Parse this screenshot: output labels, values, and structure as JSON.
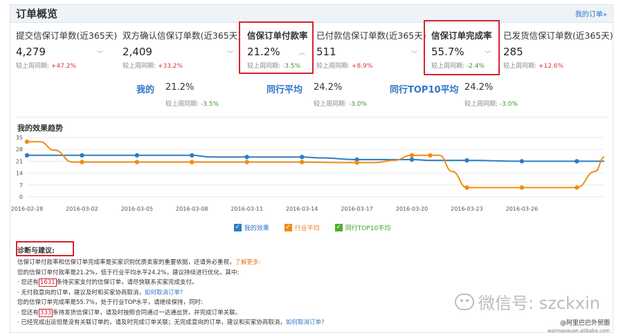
{
  "header": {
    "title": "订单概览",
    "my_orders_link": "我的订单»"
  },
  "metrics": [
    {
      "label": "提交信保订单数(近365天)",
      "value": "4,279",
      "compare_label": "较上周同期:",
      "compare_value": "+47.2%",
      "direction": "up",
      "highlighted": false
    },
    {
      "label": "双方确认信保订单数(近365天)",
      "value": "2,409",
      "compare_label": "较上周同期:",
      "compare_value": "+33.2%",
      "direction": "up",
      "highlighted": false
    },
    {
      "label": "信保订单付款率",
      "value": "21.2%",
      "compare_label": "较上周同期:",
      "compare_value": "-3.5%",
      "direction": "down",
      "highlighted": true
    },
    {
      "label": "已付款信保订单数(近365天)",
      "value": "511",
      "compare_label": "较上周同期:",
      "compare_value": "+8.9%",
      "direction": "up",
      "highlighted": false
    },
    {
      "label": "信保订单完成率",
      "value": "55.7%",
      "compare_label": "较上周同期:",
      "compare_value": "-2.4%",
      "direction": "down",
      "highlighted": true
    },
    {
      "label": "已发货信保订单数(近365天)",
      "value": "285",
      "compare_label": "较上周同期:",
      "compare_value": "+12.6%",
      "direction": "up",
      "highlighted": false
    }
  ],
  "comparison": [
    {
      "label": "我的",
      "value": "21.2%",
      "compare_label": "较上周同期:",
      "compare_value": "-3.5%"
    },
    {
      "label": "同行平均",
      "value": "24.2%",
      "compare_label": "较上周同期:",
      "compare_value": "-3.0%"
    },
    {
      "label": "同行TOP10平均",
      "value": "24.2%",
      "compare_label": "较上周同期:",
      "compare_value": "-3.0%"
    }
  ],
  "chart_title": "我的效果趋势",
  "chart_data": {
    "type": "line",
    "ylim": [
      0,
      35
    ],
    "yticks": [
      0,
      7,
      14,
      21,
      28,
      35
    ],
    "x_labels": [
      "2016-02-28",
      "2016-03-02",
      "2016-03-05",
      "2016-03-08",
      "2016-03-11",
      "2016-03-14",
      "2016-03-17",
      "2016-03-20",
      "2016-03-23",
      "2016-03-26"
    ],
    "grid": true,
    "series": [
      {
        "name": "我的效果",
        "color": "#2a7dc8",
        "points": [
          [
            0,
            24.5
          ],
          [
            3,
            24.5
          ],
          [
            6,
            24.5
          ],
          [
            9,
            24.5
          ],
          [
            10,
            23.5
          ],
          [
            12,
            23.5
          ],
          [
            15,
            23.5
          ],
          [
            16,
            23.0
          ],
          [
            18,
            22.0
          ],
          [
            21,
            22.0
          ],
          [
            22,
            21.5
          ],
          [
            24,
            21.5
          ],
          [
            27,
            21.0
          ],
          [
            30,
            21.0
          ],
          [
            31.5,
            21.0
          ]
        ],
        "markers": [
          0,
          3,
          6,
          9,
          12,
          15,
          18,
          21,
          24,
          27,
          30
        ]
      },
      {
        "name": "行业平均",
        "color": "#f08c14",
        "points": [
          [
            0,
            32.5
          ],
          [
            0.7,
            32.5
          ],
          [
            1.5,
            27.5
          ],
          [
            2.5,
            20.5
          ],
          [
            6,
            20.5
          ],
          [
            9,
            20.5
          ],
          [
            12,
            20.5
          ],
          [
            15,
            20.5
          ],
          [
            17,
            20.2
          ],
          [
            19,
            20.2
          ],
          [
            20,
            21.5
          ],
          [
            21,
            24.5
          ],
          [
            22.5,
            24.5
          ],
          [
            23.2,
            15.0
          ],
          [
            24,
            5.5
          ],
          [
            27,
            5.5
          ],
          [
            29,
            5.5
          ],
          [
            30,
            5.5
          ],
          [
            31,
            15.0
          ],
          [
            31.5,
            23.5
          ]
        ],
        "markers": [
          0,
          3,
          6,
          9,
          12,
          15,
          18,
          21,
          22,
          24,
          27,
          30
        ]
      }
    ]
  },
  "legend": [
    {
      "label": "我的效果",
      "color": "#2a7dc8"
    },
    {
      "label": "行业平均",
      "color": "#f08c14"
    },
    {
      "label": "同行TOP10平均",
      "color": "#4cae2e"
    }
  ],
  "diagnosis": {
    "title": "诊断与建议:",
    "intro": "信保订单付款率和信保订单完成率是买家识别优质卖家的重要依据，还请务必重视，",
    "learn_more": "了解更多:",
    "line1": "您的信保订单付款率是21.2%，低于行业平均水平24.2%，建议持续进行优化，其中:",
    "line2_pre": "· 您还有",
    "line2_num": "1631",
    "line2_post": "条待买家支付的信保订单，请尽快联系买家完成支付。",
    "line3_pre": "· 无付款意向的订单，建议及时和买家协商取消，",
    "line3_link": "如何取消订单?",
    "line4": "您的信保订单完成率是55.7%，处于行业TOP水平，请继续保持，同时:",
    "line5_pre": "· 您还有",
    "line5_num": "333",
    "line5_post": "条待发货信保订单，请及时按照合同通过一达通出货，并完成订单关联。",
    "line6_pre": "· 已经完成出运但是没有关联订单的，请及时完成订单关联；无完成意向的订单，建议和买家协商取消，",
    "line6_link": "如何取消订单?"
  },
  "watermark": {
    "text": "微信号: szckxin"
  },
  "corner": {
    "brand": "@阿里巴巴外贸圈",
    "url": "waimaoquan.alibaba.com"
  }
}
